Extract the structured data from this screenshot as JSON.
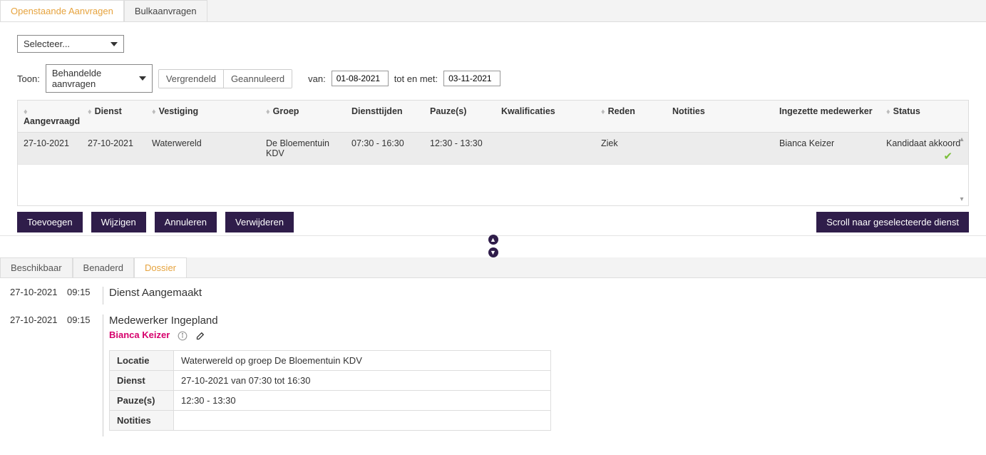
{
  "tabs": {
    "open": "Openstaande Aanvragen",
    "bulk": "Bulkaanvragen"
  },
  "selector_placeholder": "Selecteer...",
  "toon_label": "Toon:",
  "toon_value": "Behandelde aanvragen",
  "chips": {
    "vergrendeld": "Vergrendeld",
    "geannuleerd": "Geannuleerd"
  },
  "van_label": "van:",
  "van_value": "01-08-2021",
  "tot_label": "tot en met:",
  "tot_value": "03-11-2021",
  "columns": {
    "aangevraagd": "Aangevraagd",
    "dienst": "Dienst",
    "vestiging": "Vestiging",
    "groep": "Groep",
    "diensttijden": "Diensttijden",
    "pauzes": "Pauze(s)",
    "kwalificaties": "Kwalificaties",
    "reden": "Reden",
    "notities": "Notities",
    "medewerker": "Ingezette medewerker",
    "status": "Status"
  },
  "row": {
    "aangevraagd": "27-10-2021",
    "dienst": "27-10-2021",
    "vestiging": "Waterwereld",
    "groep": "De Bloementuin KDV",
    "diensttijden": "07:30  -  16:30",
    "pauzes": "12:30  -  13:30",
    "kwalificaties": "",
    "reden": "Ziek",
    "notities": "",
    "medewerker": "Bianca Keizer",
    "status": "Kandidaat akkoord"
  },
  "buttons": {
    "toevoegen": "Toevoegen",
    "wijzigen": "Wijzigen",
    "annuleren": "Annuleren",
    "verwijderen": "Verwijderen",
    "scroll": "Scroll naar geselecteerde dienst"
  },
  "subtabs": {
    "beschikbaar": "Beschikbaar",
    "benaderd": "Benaderd",
    "dossier": "Dossier"
  },
  "dossier": {
    "e1_date": "27-10-2021",
    "e1_time": "09:15",
    "e1_title": "Dienst Aangemaakt",
    "e2_date": "27-10-2021",
    "e2_time": "09:15",
    "e2_title": "Medewerker Ingepland",
    "e2_employee": "Bianca Keizer",
    "details": {
      "locatie_label": "Locatie",
      "locatie_value": "Waterwereld op groep De Bloementuin KDV",
      "dienst_label": "Dienst",
      "dienst_value": "27-10-2021 van 07:30 tot 16:30",
      "pauzes_label": "Pauze(s)",
      "pauzes_value": "12:30 - 13:30",
      "notities_label": "Notities",
      "notities_value": ""
    }
  }
}
